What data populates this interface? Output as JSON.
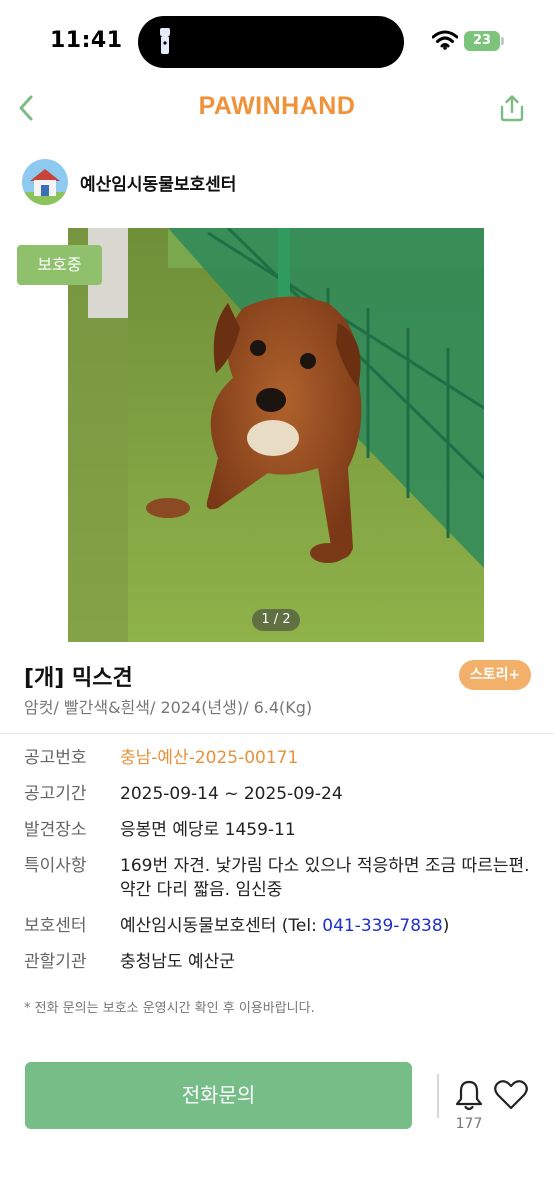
{
  "status_bar": {
    "time": "11:41",
    "battery": "23"
  },
  "header": {
    "logo": "PAWINHAND",
    "brand_color": "#f0923a"
  },
  "shelter": {
    "name": "예산임시동물보호센터"
  },
  "photo": {
    "status_badge": "보호중",
    "counter": "1 / 2"
  },
  "animal": {
    "title": "[개] 믹스견",
    "story_button": "스토리+",
    "subtitle": "암컷/ 빨간색&흰색/ 2024(년생)/ 6.4(Kg)"
  },
  "info": [
    {
      "label": "공고번호",
      "value": "충남-예산-2025-00171"
    },
    {
      "label": "공고기간",
      "value": "2025-09-14 ~ 2025-09-24"
    },
    {
      "label": "발견장소",
      "value": "응봉면 예당로 1459-11"
    },
    {
      "label": "특이사항",
      "value": "169번 자견. 낯가림 다소 있으나 적응하면 조금 따르는편. 약간 다리 짧음. 임신중"
    },
    {
      "label": "보호센터",
      "value_prefix": "예산임시동물보호센터 (Tel: ",
      "tel": "041-339-7838",
      "value_suffix": ")"
    },
    {
      "label": "관할기관",
      "value": "충청남도 예산군"
    }
  ],
  "notice": "* 전화 문의는 보호소 운영시간 확인 후 이용바랍니다.",
  "footer": {
    "call_button": "전화문의",
    "bell_count": "177"
  },
  "colors": {
    "call_button": "#76bd87",
    "badge": "#8fc16c",
    "story": "#f3b06b",
    "tel": "#1d2fd0"
  }
}
